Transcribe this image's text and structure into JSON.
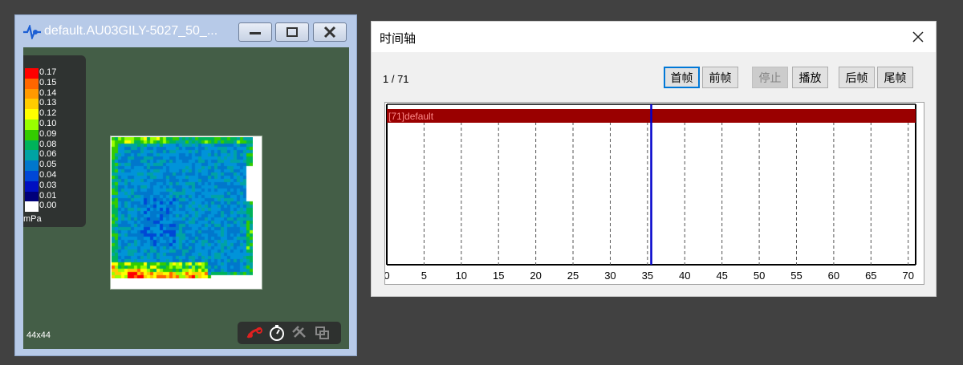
{
  "heat_window": {
    "title": "default.AU03GILY-5027_50_...",
    "icons": [
      "pulse-app-icon",
      "minimize-icon",
      "maximize-icon",
      "close-icon"
    ],
    "legend": {
      "entries": [
        {
          "label": "0.17",
          "color": "#ff0000"
        },
        {
          "label": "0.15",
          "color": "#ff6600"
        },
        {
          "label": "0.14",
          "color": "#ff9900"
        },
        {
          "label": "0.13",
          "color": "#ffcc00"
        },
        {
          "label": "0.12",
          "color": "#ffff00"
        },
        {
          "label": "0.10",
          "color": "#99ff00"
        },
        {
          "label": "0.09",
          "color": "#33cc00"
        },
        {
          "label": "0.08",
          "color": "#00b35a"
        },
        {
          "label": "0.06",
          "color": "#00a3a3"
        },
        {
          "label": "0.05",
          "color": "#0077cc"
        },
        {
          "label": "0.04",
          "color": "#0047d6"
        },
        {
          "label": "0.03",
          "color": "#0010c0"
        },
        {
          "label": "0.01",
          "color": "#00007a"
        },
        {
          "label": "0.00",
          "color": "#ffffff"
        }
      ],
      "unit": "mPa"
    },
    "grid_size": "44x44",
    "toolbar_icons": [
      "tools-icon",
      "timer-icon",
      "satellite-icon",
      "copy-icon"
    ]
  },
  "timeline": {
    "title": "时间轴",
    "frame_counter": "1 / 71",
    "buttons": {
      "first": "首帧",
      "prev": "前帧",
      "stop": "停止",
      "play": "播放",
      "next": "后帧",
      "last": "尾帧"
    },
    "track_label": "[71]default",
    "current_frame": 35.5,
    "axis_ticks": [
      0,
      5,
      10,
      15,
      20,
      25,
      30,
      35,
      40,
      45,
      50,
      55,
      60,
      65,
      70
    ],
    "axis_max": 71,
    "colors": {
      "track": "#9a0000",
      "cursor": "#0000cc",
      "focus": "#0078d7"
    }
  }
}
